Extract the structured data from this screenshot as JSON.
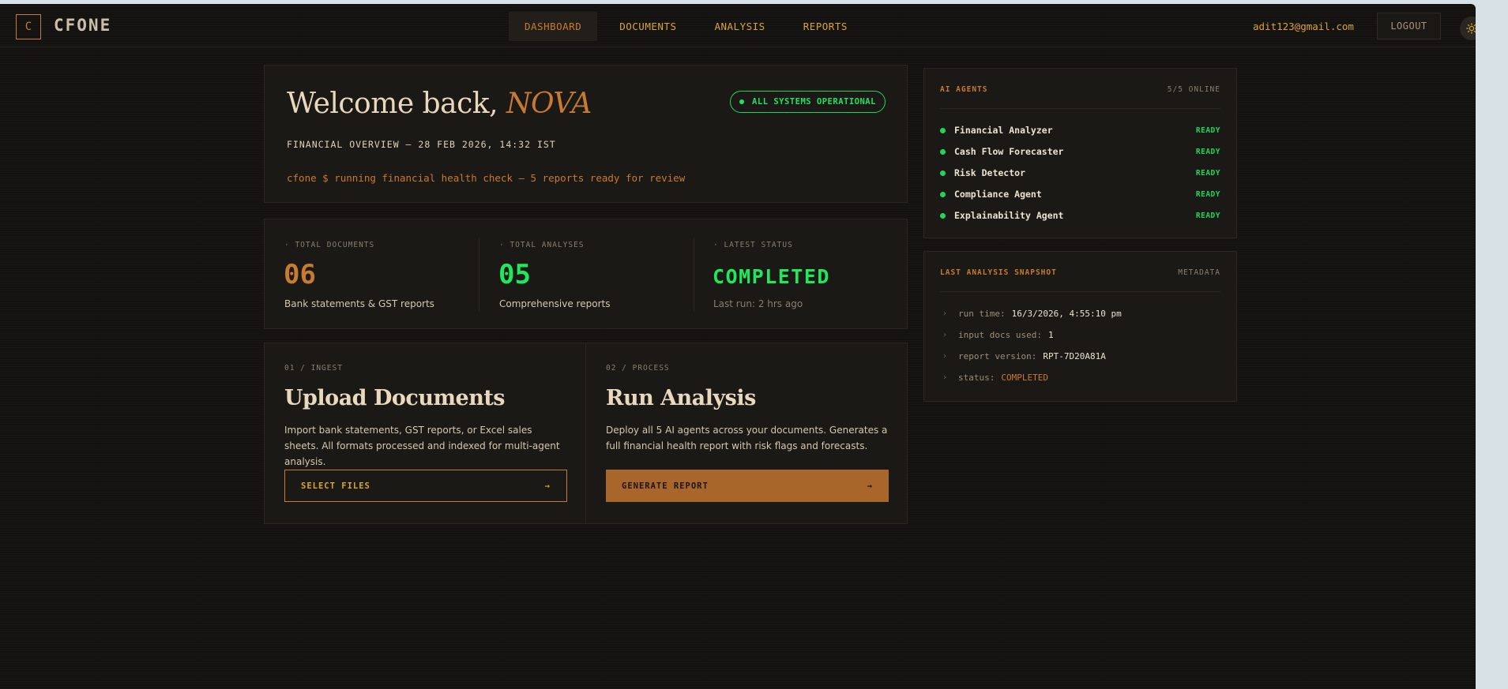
{
  "brand": {
    "logo_letter": "C",
    "name": "CFONE"
  },
  "nav": {
    "tabs": [
      {
        "label": "DASHBOARD",
        "active": true
      },
      {
        "label": "DOCUMENTS"
      },
      {
        "label": "ANALYSIS"
      },
      {
        "label": "REPORTS"
      }
    ]
  },
  "user": {
    "email": "adit123@gmail.com",
    "logout_label": "LOGOUT",
    "theme_icon": "sun-icon"
  },
  "welcome": {
    "greeting": "Welcome back, ",
    "name": "NOVA",
    "overview": "FINANCIAL OVERVIEW — 28 FEB 2026, 14:32 IST",
    "command": "cfone $ running financial health check — 5 reports ready for review",
    "status_pill": "ALL SYSTEMS OPERATIONAL"
  },
  "stats": [
    {
      "label": "· TOTAL DOCUMENTS",
      "value": "06",
      "sub": "Bank statements & GST reports",
      "color": "#c77a32"
    },
    {
      "label": "· TOTAL ANALYSES",
      "value": "05",
      "sub": "Comprehensive reports",
      "color": "#1fe85c"
    },
    {
      "label": "· LATEST STATUS",
      "value": "COMPLETED",
      "sub": "Last run: 2 hrs ago",
      "color": "#1fe85c"
    }
  ],
  "actions": [
    {
      "step": "01 / INGEST",
      "title": "Upload Documents",
      "desc": "Import bank statements, GST reports, or Excel sales sheets. All formats processed and indexed for multi-agent analysis.",
      "button": "SELECT FILES",
      "arrow": "→"
    },
    {
      "step": "02 / PROCESS",
      "title": "Run Analysis",
      "desc": "Deploy all 5 AI agents across your documents. Generates a full financial health report with risk flags and forecasts.",
      "button": "GENERATE REPORT",
      "arrow": "→"
    }
  ],
  "agents": {
    "title": "AI AGENTS",
    "online": "5/5 ONLINE",
    "items": [
      {
        "name": "Financial Analyzer",
        "status": "READY"
      },
      {
        "name": "Cash Flow Forecaster",
        "status": "READY"
      },
      {
        "name": "Risk Detector",
        "status": "READY"
      },
      {
        "name": "Compliance Agent",
        "status": "READY"
      },
      {
        "name": "Explainability Agent",
        "status": "READY"
      }
    ]
  },
  "snapshot": {
    "title": "LAST ANALYSIS SNAPSHOT",
    "tag": "METADATA",
    "rows": [
      {
        "key": "run time:",
        "value": "16/3/2026, 4:55:10 pm"
      },
      {
        "key": "input docs used:",
        "value": "1"
      },
      {
        "key": "report version:",
        "value": "RPT-7D20A81A"
      },
      {
        "key": "status:",
        "value": "COMPLETED"
      }
    ]
  }
}
